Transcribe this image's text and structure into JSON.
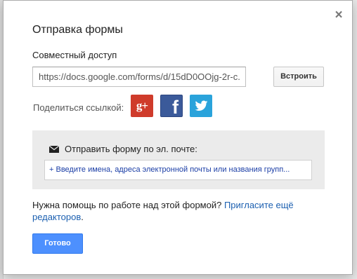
{
  "dialog": {
    "title": "Отправка формы",
    "close_symbol": "×"
  },
  "share": {
    "section_label": "Совместный доступ",
    "url_value": "https://docs.google.com/forms/d/15dD0OOjg-2r-c...",
    "embed_label": "Встроить",
    "share_link_label": "Поделиться ссылкой:",
    "buttons": [
      {
        "name": "google-plus",
        "glyph": "g+",
        "color": "#cf3b2b"
      },
      {
        "name": "facebook",
        "glyph": "f",
        "color": "#3b5a9a"
      },
      {
        "name": "twitter",
        "glyph": "",
        "color": "#2aa3db"
      }
    ]
  },
  "email": {
    "label": "Отправить форму по эл. почте:",
    "recipients_placeholder": "+ Введите имена, адреса электронной почты или названия групп..."
  },
  "help": {
    "text": "Нужна помощь по работе над этой формой? ",
    "link": "Пригласите ещё редакторов",
    "suffix": "."
  },
  "footer": {
    "done_label": "Готово"
  },
  "colors": {
    "accent": "#4d90fe",
    "link": "#1b5fb0"
  }
}
